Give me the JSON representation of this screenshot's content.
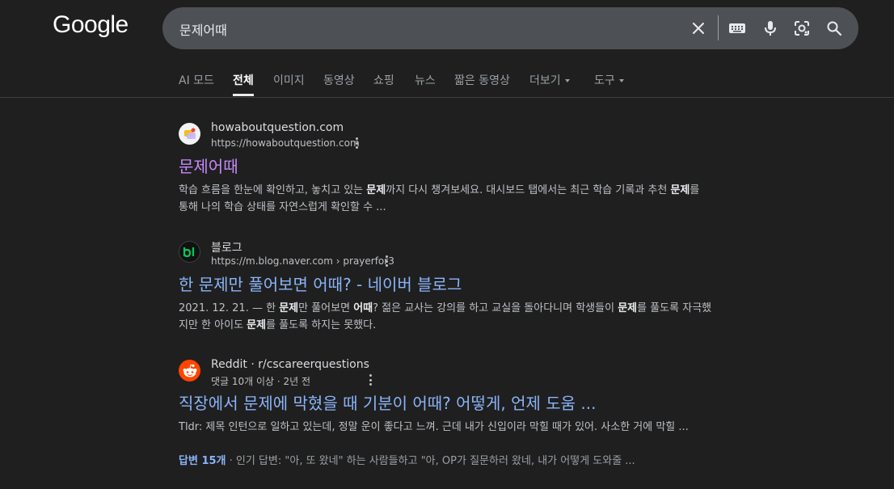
{
  "logo": "Google",
  "search": {
    "query": "문제어때"
  },
  "icons": {
    "clear": "close-icon",
    "keyboard": "keyboard-icon",
    "voice": "microphone-icon",
    "lens": "lens-icon",
    "search": "search-icon"
  },
  "tabs": [
    {
      "label": "AI 모드"
    },
    {
      "label": "전체"
    },
    {
      "label": "이미지"
    },
    {
      "label": "동영상"
    },
    {
      "label": "쇼핑"
    },
    {
      "label": "뉴스"
    },
    {
      "label": "짧은 동영상"
    },
    {
      "label": "더보기"
    },
    {
      "label": "도구"
    }
  ],
  "results": [
    {
      "site_name": "howaboutquestion.com",
      "url": "https://howaboutquestion.com",
      "title": "문제어때",
      "snippet_parts": [
        "학습 흐름을 한눈에 확인하고, 놓치고 있는 ",
        "문제",
        "까지 다시 챙겨보세요. 대시보드 탭에서는 최근 학습 기록과 추천 ",
        "문제",
        "를 통해 나의 학습 상태를 자연스럽게 확인할 수 ..."
      ]
    },
    {
      "site_name": "블로그",
      "url": "https://m.blog.naver.com › prayerfor3",
      "title": "한 문제만 풀어보면 어때? - 네이버 블로그",
      "snippet_parts": [
        "2021. 12. 21. — 한 ",
        "문제",
        "만 풀어보면 ",
        "어때",
        "? 젊은 교사는 강의를 하고 교실을 돌아다니며 학생들이 ",
        "문제",
        "를 풀도록 자극했지만 한 아이도 ",
        "문제",
        "를 풀도록 하지는 못했다."
      ]
    },
    {
      "site_name": "Reddit · r/cscareerquestions",
      "url": "댓글 10개 이상 · 2년 전",
      "title": "직장에서 문제에 막혔을 때 기분이 어때? 어떻게, 언제 도움 ...",
      "snippet_parts": [
        "Tldr: 제목 인턴으로 일하고 있는데, 정말 운이 좋다고 느껴. 근데 내가 신입이라 막힐 때가 있어. 사소한 거에 막힐 ..."
      ],
      "answers_label": "답변 15개",
      "answers_rest": " · 인기 답변: \"아, 또 왔네\" 하는 사람들하고 \"아, OP가 질문하러 왔네, 내가 어떻게 도와줄 ..."
    }
  ],
  "colors": {
    "background": "#1f1f1f",
    "searchbox": "#4d5156",
    "link": "#8ab4f8",
    "visited": "#c58af9",
    "reddit": "#ff4500",
    "blog": "#03c75a"
  }
}
